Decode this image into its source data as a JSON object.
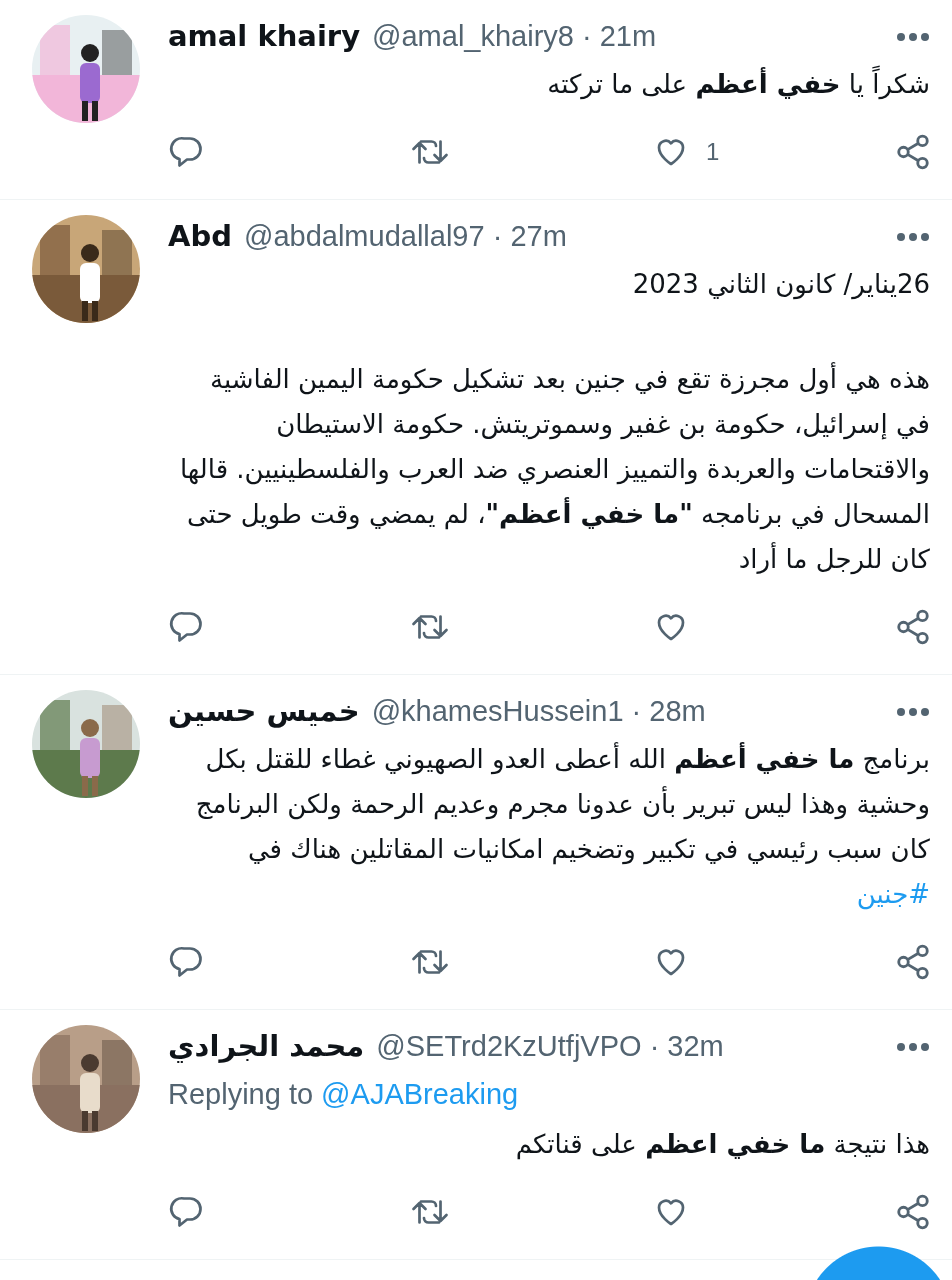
{
  "tweets": [
    {
      "name": "amal khairy",
      "meta": "@amal_khairy8 · 21m",
      "avatar": {
        "kind": "picture"
      },
      "paragraphs": [
        {
          "text": "شكراً يا **خفي أعظم** على ما تركته"
        }
      ],
      "like_count": "1"
    },
    {
      "name": "Abd",
      "meta": "@abdalmudallal97 · 27m",
      "avatar": {
        "kind": "picture"
      },
      "paragraphs": [
        {
          "text": "26يناير/ كانون الثاني 2023"
        },
        {
          "text": "هذه هي أول مجرزة تقع في جنين بعد تشكيل حكومة اليمين الفاشية في إسرائيل، حكومة بن غفير وسموتريتش. حكومة الاستيطان والاقتحامات والعربدة والتمييز العنصري ضد العرب والفلسطينيين. قالها المسحال في برنامجه **\"ما خفي أعظم\"**، لم يمضي وقت طويل حتى كان للرجل ما أراد"
        }
      ]
    },
    {
      "name": "خميس حسين",
      "meta": "@khamesHussein1 · 28m",
      "avatar": {
        "kind": "picture"
      },
      "paragraphs": [
        {
          "text": "برنامج **ما خفي أعظم** الله أعطى العدو الصهيوني غطاء للقتل بكل وحشية وهذا ليس تبرير بأن عدونا مجرم وعديم الرحمة ولكن البرنامج كان سبب رئيسي في تكبير وتضخيم امكانيات المقاتلين هناك في ",
          "link": "#جنين"
        }
      ]
    },
    {
      "name": "محمد الجرادي",
      "meta": "@SETrd2KzUtfjVPO · 32m",
      "avatar": {
        "kind": "picture"
      },
      "replying_to": {
        "label": "Replying to",
        "handle": "@AJABreaking"
      },
      "paragraphs": [
        {
          "text": "هذا نتيجة **ما خفي اعظم** على قناتكم"
        }
      ]
    }
  ]
}
